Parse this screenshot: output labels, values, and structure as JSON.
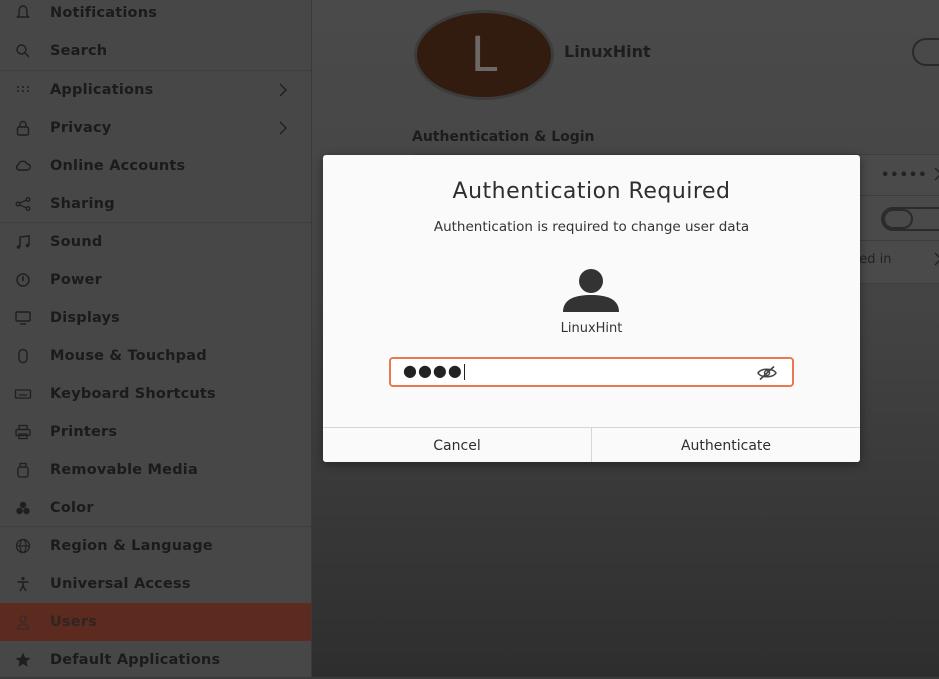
{
  "sidebar": {
    "items": [
      {
        "label": "Notifications",
        "icon": "bell-icon"
      },
      {
        "label": "Search",
        "icon": "search-icon"
      },
      {
        "label": "Applications",
        "icon": "grid-icon",
        "has_arrow": true
      },
      {
        "label": "Privacy",
        "icon": "lock-icon",
        "has_arrow": true
      },
      {
        "label": "Online Accounts",
        "icon": "cloud-icon"
      },
      {
        "label": "Sharing",
        "icon": "share-icon"
      },
      {
        "label": "Sound",
        "icon": "music-note-icon"
      },
      {
        "label": "Power",
        "icon": "power-icon"
      },
      {
        "label": "Displays",
        "icon": "display-icon"
      },
      {
        "label": "Mouse & Touchpad",
        "icon": "mouse-icon"
      },
      {
        "label": "Keyboard Shortcuts",
        "icon": "keyboard-icon"
      },
      {
        "label": "Printers",
        "icon": "printer-icon"
      },
      {
        "label": "Removable Media",
        "icon": "removable-media-icon"
      },
      {
        "label": "Color",
        "icon": "color-icon"
      },
      {
        "label": "Region & Language",
        "icon": "globe-icon"
      },
      {
        "label": "Universal Access",
        "icon": "accessibility-icon"
      },
      {
        "label": "Users",
        "icon": "user-icon",
        "active": true
      },
      {
        "label": "Default Applications",
        "icon": "star-icon"
      }
    ]
  },
  "user_panel": {
    "avatar_letter": "L",
    "user_name": "LinuxHint",
    "section_title": "Authentication & Login",
    "password_mask": "•••••",
    "logged_in_text": "ged in"
  },
  "dialog": {
    "title": "Authentication Required",
    "subtitle": "Authentication is required to change user data",
    "username": "LinuxHint",
    "password_value": "●●●●",
    "cancel_label": "Cancel",
    "authenticate_label": "Authenticate"
  },
  "colors": {
    "accent_orange": "#e97951",
    "active_item_bg": "#5c2a1e"
  }
}
